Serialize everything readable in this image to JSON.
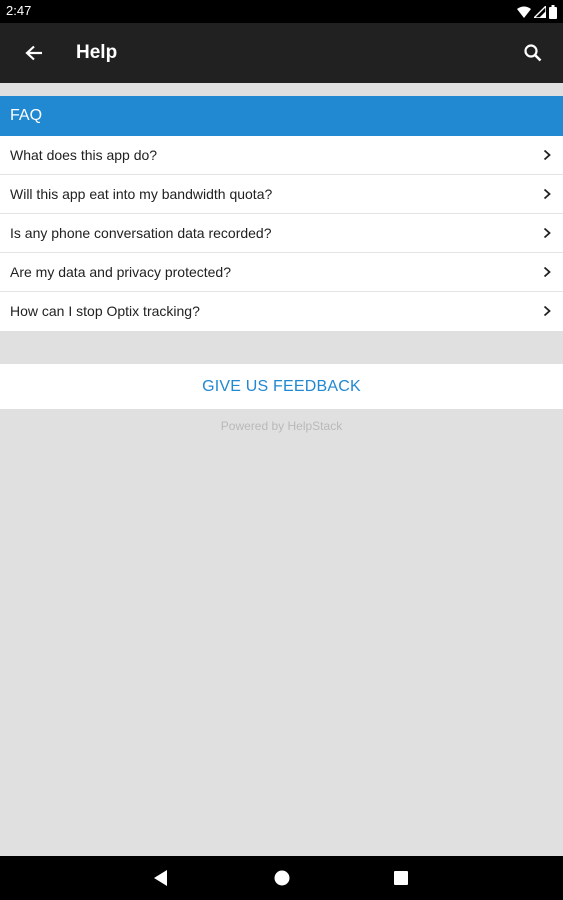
{
  "status_bar": {
    "time": "2:47",
    "icons": [
      "wifi-icon",
      "cellular-signal-icon",
      "battery-icon"
    ]
  },
  "app_bar": {
    "title": "Help",
    "back_icon": "arrow-left-icon",
    "search_icon": "search-icon"
  },
  "faq": {
    "header": "FAQ",
    "items": [
      {
        "label": "What does this app do?"
      },
      {
        "label": "Will this app eat into my bandwidth quota?"
      },
      {
        "label": "Is any phone conversation data recorded?"
      },
      {
        "label": "Are my data and privacy protected?"
      },
      {
        "label": "How can I stop Optix tracking?"
      }
    ]
  },
  "feedback": {
    "label": "GIVE US FEEDBACK"
  },
  "footer": {
    "powered_by": "Powered by HelpStack"
  },
  "nav_bar": {
    "icons": [
      "back-triangle-icon",
      "home-circle-icon",
      "recents-square-icon"
    ]
  },
  "colors": {
    "accent": "#2189d1",
    "app_bar": "#212121",
    "background": "#e0e0e0"
  }
}
